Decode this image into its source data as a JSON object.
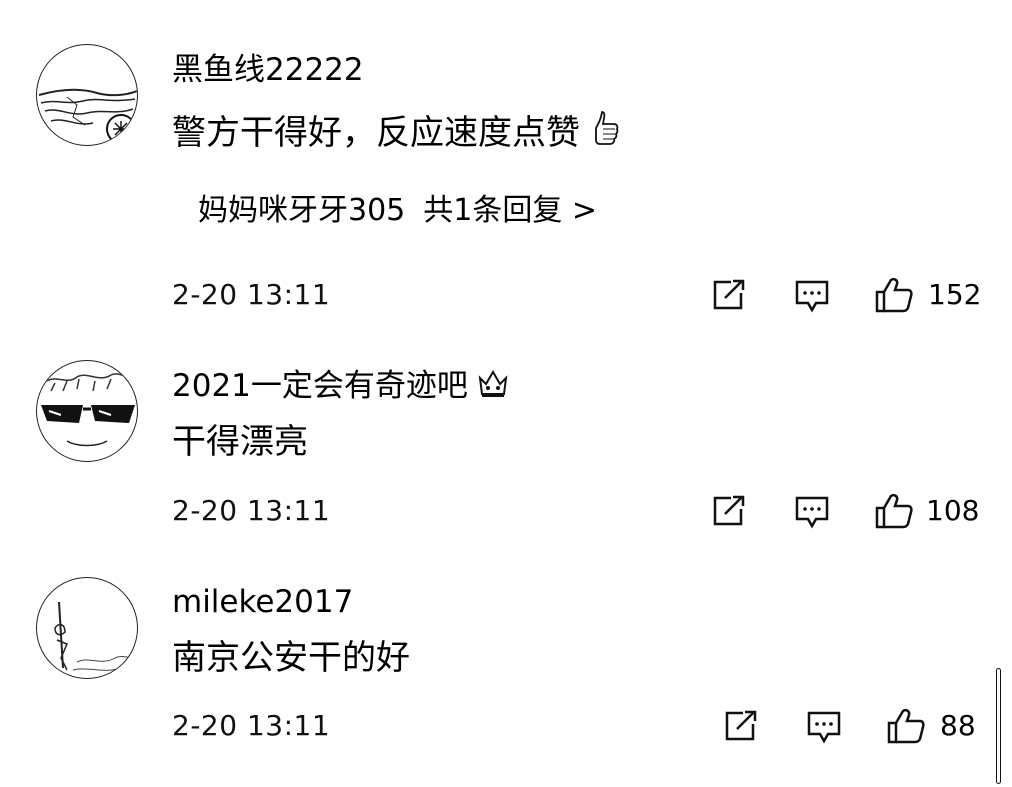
{
  "comments": [
    {
      "username": "黑鱼线22222",
      "text": "警方干得好，反应速度点赞",
      "text_emoji": "thumbs-up-emoji",
      "reply": {
        "author": "妈妈咪牙牙305",
        "summary": "共1条回复 >"
      },
      "time": "2-20 13:11",
      "likes": "152"
    },
    {
      "username": "2021一定会有奇迹吧",
      "username_emoji": "crown-emoji",
      "text": "干得漂亮",
      "time": "2-20 13:11",
      "likes": "108"
    },
    {
      "username": "mileke2017",
      "text": "南京公安干的好",
      "time": "2-20 13:11",
      "likes": "88"
    }
  ]
}
